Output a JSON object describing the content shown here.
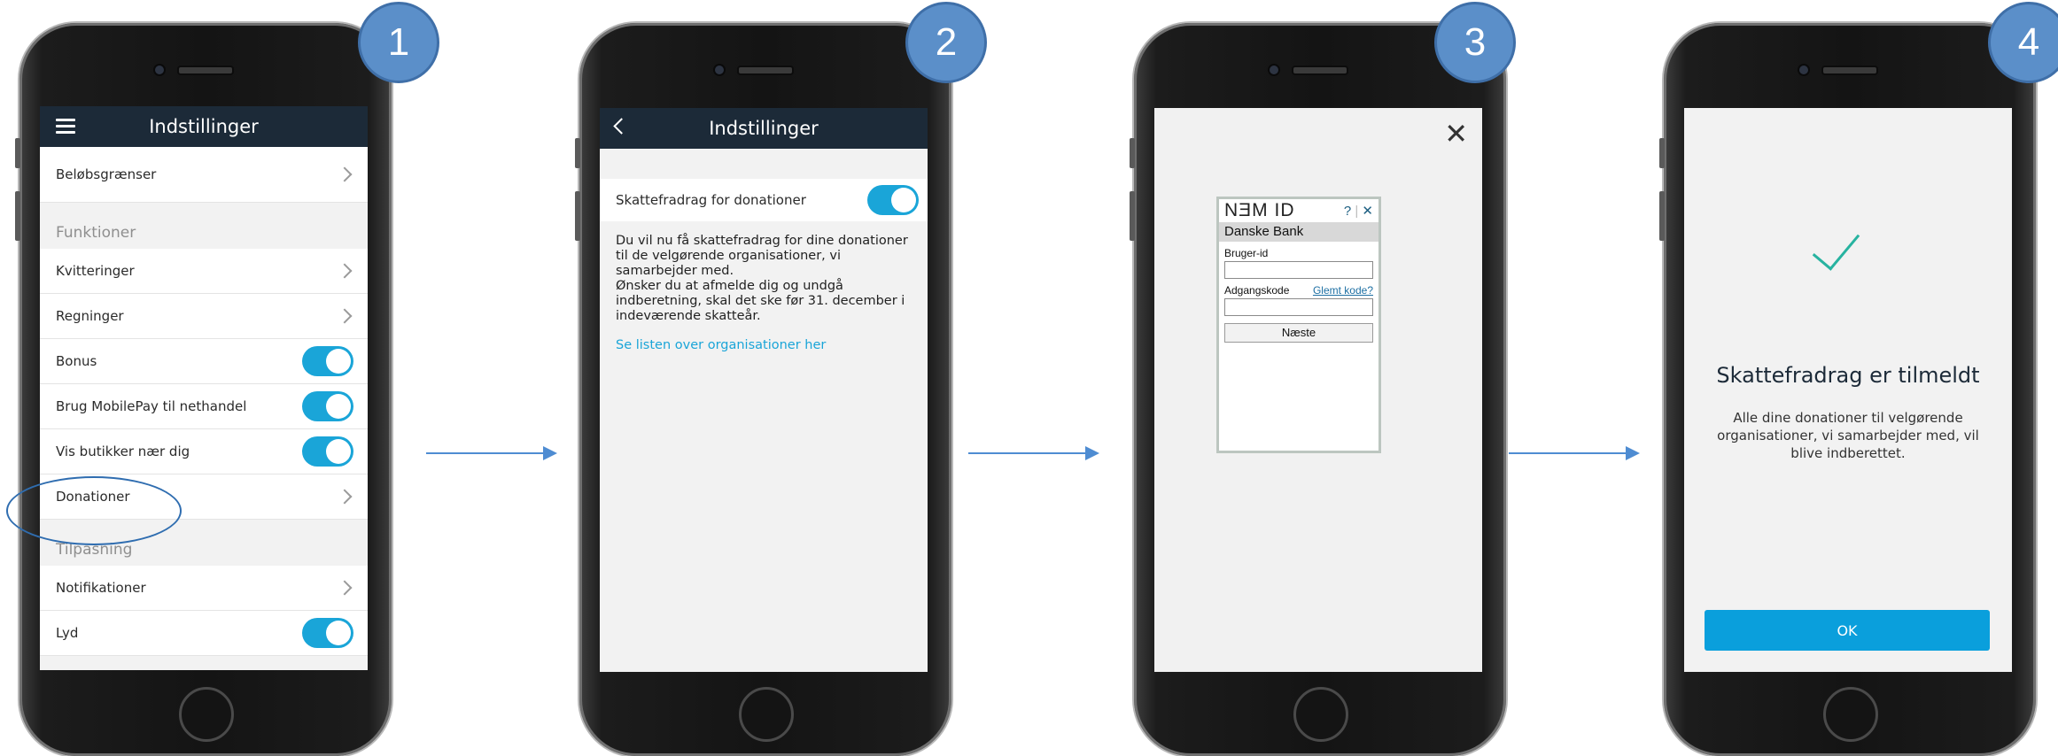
{
  "badges": [
    "1",
    "2",
    "3",
    "4"
  ],
  "screen1": {
    "title": "Indstillinger",
    "top_item": "Beløbsgrænser",
    "section_functions": "Funktioner",
    "functions": [
      {
        "label": "Kvitteringer",
        "control": "chevron"
      },
      {
        "label": "Regninger",
        "control": "chevron"
      },
      {
        "label": "Bonus",
        "control": "toggle-on"
      },
      {
        "label": "Brug MobilePay til nethandel",
        "control": "toggle-on"
      },
      {
        "label": "Vis butikker nær dig",
        "control": "toggle-on"
      },
      {
        "label": "Donationer",
        "control": "chevron"
      }
    ],
    "section_adjust": "Tilpasning",
    "adjust": [
      {
        "label": "Notifikationer",
        "control": "chevron"
      },
      {
        "label": "Lyd",
        "control": "toggle-on"
      }
    ]
  },
  "screen2": {
    "title": "Indstillinger",
    "toggle_label": "Skattefradrag for donationer",
    "description": "Du vil nu få skattefradrag for dine donationer\ntil de velgørende organisationer, vi\nsamarbejder med.\nØnsker du at afmelde dig og undgå\nindberetning, skal det ske før 31. december i\nindeværende skatteår.",
    "link": "Se listen over organisationer her"
  },
  "screen3": {
    "close": "✕",
    "nemid": {
      "logo": "NƎM ID",
      "help": "?",
      "close": "✕",
      "bank": "Danske Bank",
      "user_label": "Bruger-id",
      "password_label": "Adgangskode",
      "forgot": "Glemt kode?",
      "next_button": "Næste"
    }
  },
  "screen4": {
    "title": "Skattefradrag er tilmeldt",
    "text": "Alle dine donationer til velgørende organisationer, vi samarbejder med, vil blive indberettet.",
    "ok": "OK"
  },
  "colors": {
    "accent": "#1aa5d8",
    "topbar": "#1c2a38",
    "badge": "#5b8fc9",
    "arrow": "#4e8cd2",
    "checkmark": "#27b3a0"
  }
}
